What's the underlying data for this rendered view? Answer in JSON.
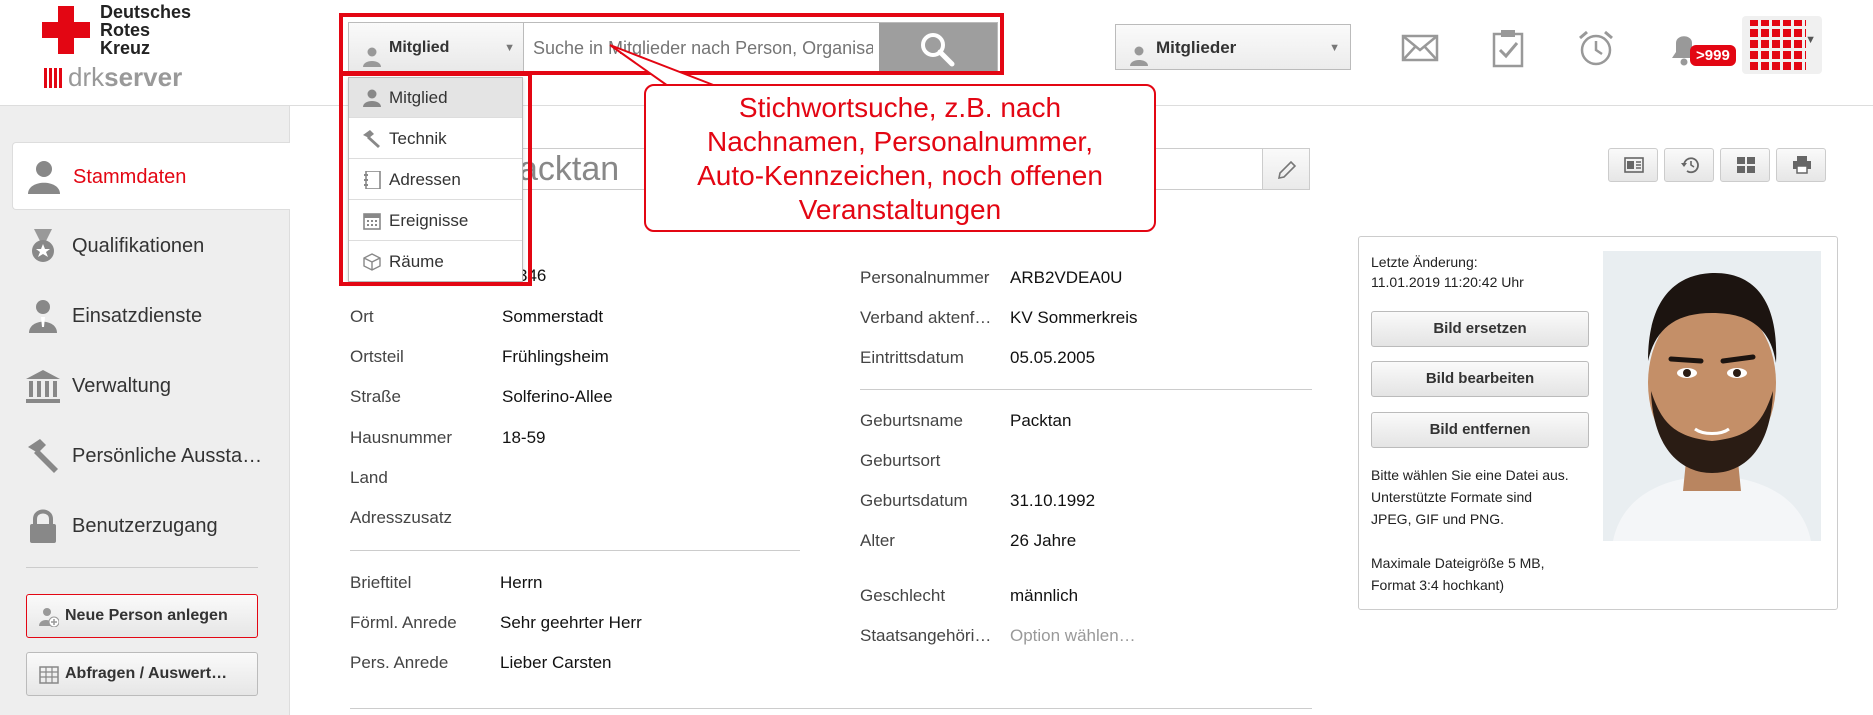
{
  "brand": {
    "line1": "Deutsches",
    "line2": "Rotes",
    "line3": "Kreuz",
    "server_prefix": "drk",
    "server_suffix": "server",
    "brand_color": "#e30613"
  },
  "search": {
    "type_selected": "Mitglied",
    "placeholder": "Suche in Mitglieder nach Person, Organisat",
    "button_icon": "search-icon",
    "type_options": [
      {
        "label": "Mitglied",
        "icon": "person-icon"
      },
      {
        "label": "Technik",
        "icon": "hammer-icon"
      },
      {
        "label": "Adressen",
        "icon": "address-book-icon"
      },
      {
        "label": "Ereignisse",
        "icon": "calendar-icon"
      },
      {
        "label": "Räume",
        "icon": "cube-icon"
      }
    ]
  },
  "scope": {
    "selected": "Mitglieder"
  },
  "header_icons": {
    "mail": "mail-icon",
    "tasks": "clipboard-check-icon",
    "alarm": "alarm-clock-icon",
    "bell": "bell-icon",
    "badge": ">999",
    "apps": "apps-grid-icon"
  },
  "callout": {
    "line1": "Stichwortsuche, z.B. nach",
    "line2": "Nachnamen, Personalnummer,",
    "line3": "Auto-Kennzeichen, noch offenen",
    "line4": "Veranstaltungen"
  },
  "sidebar": {
    "items": [
      {
        "label": "Stammdaten",
        "icon": "person-icon",
        "active": true
      },
      {
        "label": "Qualifikationen",
        "icon": "medal-icon",
        "active": false
      },
      {
        "label": "Einsatzdienste",
        "icon": "officer-icon",
        "active": false
      },
      {
        "label": "Verwaltung",
        "icon": "building-icon",
        "active": false
      },
      {
        "label": "Persönliche Aussta…",
        "icon": "hammer-icon",
        "active": false
      },
      {
        "label": "Benutzerzugang",
        "icon": "lock-icon",
        "active": false
      }
    ],
    "new_person_button": "Neue Person anlegen",
    "queries_button": "Abfragen / Auswert…"
  },
  "person": {
    "name_visible": "acktan"
  },
  "address_fields": [
    {
      "label": "",
      "value": "346"
    },
    {
      "label": "Ort",
      "value": "Sommerstadt"
    },
    {
      "label": "Ortsteil",
      "value": "Frühlingsheim"
    },
    {
      "label": "Straße",
      "value": "Solferino-Allee"
    },
    {
      "label": "Hausnummer",
      "value": "18-59"
    },
    {
      "label": "Land",
      "value": ""
    },
    {
      "label": "Adresszusatz",
      "value": ""
    }
  ],
  "salutation_fields": [
    {
      "label": "Brieftitel",
      "value": "Herrn"
    },
    {
      "label": "Förml. Anrede",
      "value": "Sehr geehrter Herr"
    },
    {
      "label": "Pers. Anrede",
      "value": "Lieber Carsten"
    }
  ],
  "member_fields": [
    {
      "label": "Personalnummer",
      "value": "ARB2VDEA0U"
    },
    {
      "label": "Verband aktenf…",
      "value": "KV Sommerkreis"
    },
    {
      "label": "Eintrittsdatum",
      "value": "05.05.2005"
    }
  ],
  "birth_fields": [
    {
      "label": "Geburtsname",
      "value": "Packtan"
    },
    {
      "label": "Geburtsort",
      "value": ""
    },
    {
      "label": "Geburtsdatum",
      "value": "31.10.1992"
    },
    {
      "label": "Alter",
      "value": "26 Jahre"
    }
  ],
  "gender_fields": [
    {
      "label": "Geschlecht",
      "value": "männlich"
    },
    {
      "label": "Staatsangehöri…",
      "value": "Option wählen…"
    }
  ],
  "photo_panel": {
    "last_change_label": "Letzte Änderung:",
    "last_change_value": "11.01.2019 11:20:42 Uhr",
    "replace_button": "Bild ersetzen",
    "edit_button": "Bild bearbeiten",
    "remove_button": "Bild entfernen",
    "hint1": "Bitte wählen Sie eine Datei aus.",
    "hint2": "Unterstützte Formate sind",
    "hint3": "JPEG, GIF und PNG.",
    "hint4": "Maximale Dateigröße 5 MB,",
    "hint5": "Format 3:4 hochkant)"
  }
}
